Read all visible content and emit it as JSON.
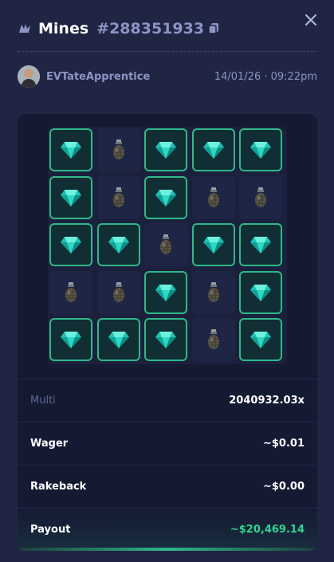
{
  "header": {
    "title": "Mines",
    "bet_id": "#288351933",
    "game_icon": "mines-game-icon",
    "copy_icon": "copy-icon",
    "close_icon": "close-icon"
  },
  "user": {
    "name": "EVTateApprentice",
    "timestamp": "14/01/26 · 09:22pm"
  },
  "board": {
    "tiles": [
      "gem",
      "mine",
      "gem",
      "gem",
      "gem",
      "gem",
      "mine",
      "gem",
      "mine",
      "mine",
      "gem",
      "gem",
      "mine",
      "gem",
      "gem",
      "mine",
      "mine",
      "gem",
      "mine",
      "gem",
      "gem",
      "gem",
      "gem",
      "mine",
      "gem"
    ]
  },
  "stats": {
    "multi_label": "Multi",
    "multi_value": "2040932.03x",
    "wager_label": "Wager",
    "wager_value": "~$0.01",
    "rakeback_label": "Rakeback",
    "rakeback_value": "~$0.00",
    "payout_label": "Payout",
    "payout_value": "~$20,469.14"
  },
  "colors": {
    "background": "#1f2543",
    "card": "#151a33",
    "gem_border": "#2fb889",
    "payout_green": "#32d492",
    "muted": "#8a95c4"
  }
}
